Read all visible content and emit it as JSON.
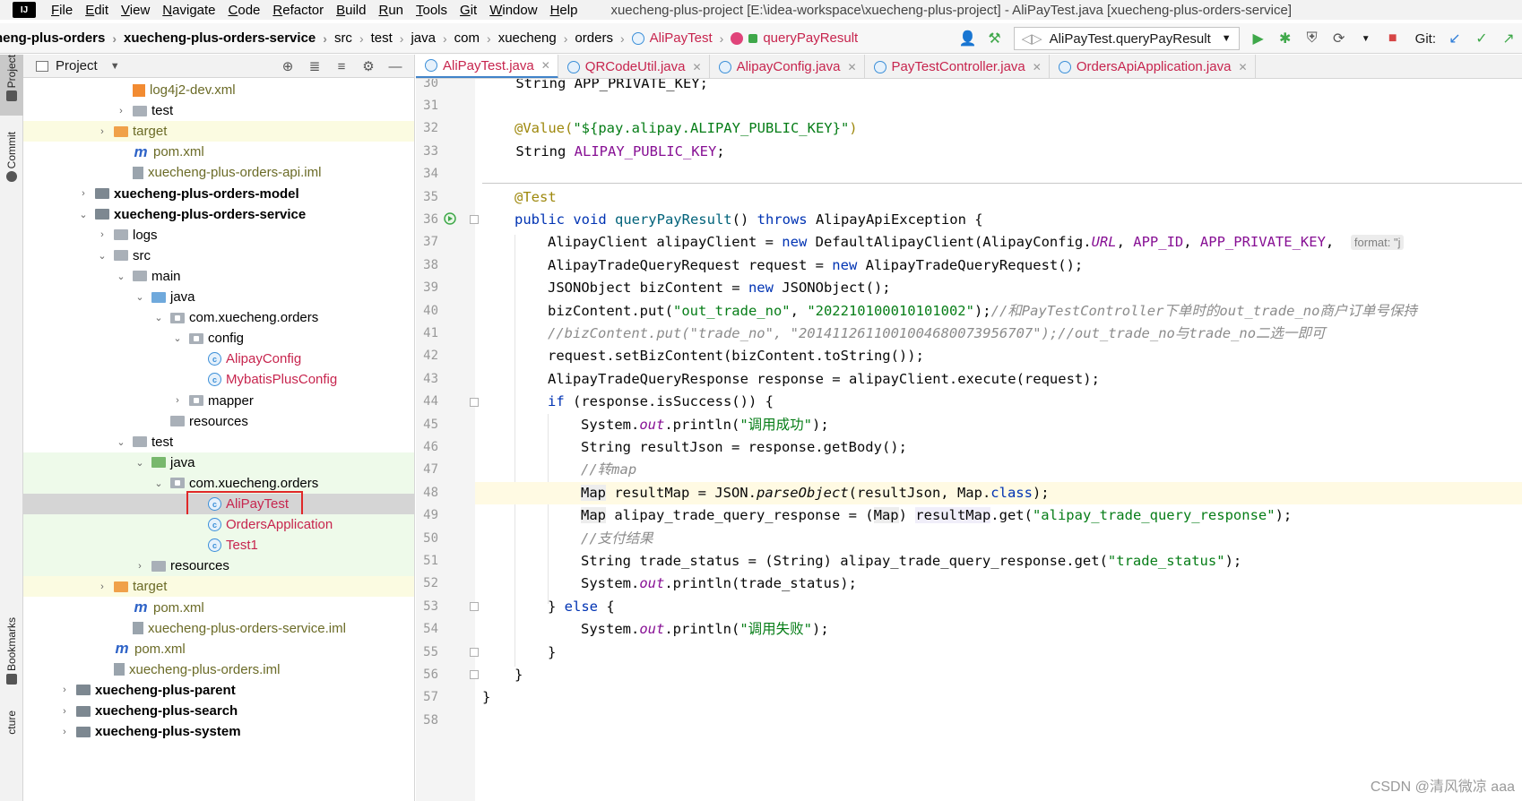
{
  "menubar": {
    "logo": "IJ",
    "items": [
      "File",
      "Edit",
      "View",
      "Navigate",
      "Code",
      "Refactor",
      "Build",
      "Run",
      "Tools",
      "Git",
      "Window",
      "Help"
    ],
    "title": "xuecheng-plus-project [E:\\idea-workspace\\xuecheng-plus-project] - AliPayTest.java [xuecheng-plus-orders-service]"
  },
  "navbar": {
    "crumbs": [
      "heng-plus-orders",
      "xuecheng-plus-orders-service",
      "src",
      "test",
      "java",
      "com",
      "xuecheng",
      "orders",
      "AliPayTest",
      "queryPayResult"
    ],
    "run_config": "AliPayTest.queryPayResult",
    "git_label": "Git:"
  },
  "left_strip": {
    "project": "Project",
    "commit": "Commit",
    "bookmarks": "Bookmarks",
    "structure": "cture"
  },
  "project_panel": {
    "title": "Project",
    "tree": [
      {
        "label": "log4j2-dev.xml",
        "depth": 4,
        "icon": "xml",
        "style": "olive",
        "arrow": ""
      },
      {
        "label": "test",
        "depth": 4,
        "icon": "folder",
        "style": "",
        "arrow": "›"
      },
      {
        "label": "target",
        "depth": 3,
        "icon": "folder-orange",
        "style": "olive",
        "arrow": "›",
        "bg": "yellow"
      },
      {
        "label": "pom.xml",
        "depth": 4,
        "icon": "maven",
        "style": "olive",
        "arrow": ""
      },
      {
        "label": "xuecheng-plus-orders-api.iml",
        "depth": 4,
        "icon": "iml",
        "style": "olive",
        "arrow": ""
      },
      {
        "label": "xuecheng-plus-orders-model",
        "depth": 2,
        "icon": "module",
        "style": "bold",
        "arrow": "›"
      },
      {
        "label": "xuecheng-plus-orders-service",
        "depth": 2,
        "icon": "module",
        "style": "bold",
        "arrow": "⌄"
      },
      {
        "label": "logs",
        "depth": 3,
        "icon": "folder",
        "style": "",
        "arrow": "›"
      },
      {
        "label": "src",
        "depth": 3,
        "icon": "folder",
        "style": "",
        "arrow": "⌄"
      },
      {
        "label": "main",
        "depth": 4,
        "icon": "folder",
        "style": "",
        "arrow": "⌄"
      },
      {
        "label": "java",
        "depth": 5,
        "icon": "folder-blue",
        "style": "",
        "arrow": "⌄"
      },
      {
        "label": "com.xuecheng.orders",
        "depth": 6,
        "icon": "package",
        "style": "",
        "arrow": "⌄"
      },
      {
        "label": "config",
        "depth": 7,
        "icon": "package",
        "style": "",
        "arrow": "⌄"
      },
      {
        "label": "AlipayConfig",
        "depth": 8,
        "icon": "class",
        "style": "red",
        "arrow": ""
      },
      {
        "label": "MybatisPlusConfig",
        "depth": 8,
        "icon": "class",
        "style": "red",
        "arrow": ""
      },
      {
        "label": "mapper",
        "depth": 7,
        "icon": "package",
        "style": "",
        "arrow": "›"
      },
      {
        "label": "resources",
        "depth": 6,
        "icon": "folder",
        "style": "",
        "arrow": ""
      },
      {
        "label": "test",
        "depth": 4,
        "icon": "folder",
        "style": "",
        "arrow": "⌄"
      },
      {
        "label": "java",
        "depth": 5,
        "icon": "folder-green",
        "style": "",
        "arrow": "⌄",
        "bg": "green"
      },
      {
        "label": "com.xuecheng.orders",
        "depth": 6,
        "icon": "package",
        "style": "",
        "arrow": "⌄",
        "bg": "green"
      },
      {
        "label": "AliPayTest",
        "depth": 8,
        "icon": "class",
        "style": "red",
        "arrow": "",
        "bg": "selected"
      },
      {
        "label": "OrdersApplication",
        "depth": 8,
        "icon": "class",
        "style": "red",
        "arrow": "",
        "bg": "green"
      },
      {
        "label": "Test1",
        "depth": 8,
        "icon": "class",
        "style": "red",
        "arrow": "",
        "bg": "green"
      },
      {
        "label": "resources",
        "depth": 5,
        "icon": "folder",
        "style": "",
        "arrow": "›",
        "bg": "green"
      },
      {
        "label": "target",
        "depth": 3,
        "icon": "folder-orange",
        "style": "olive",
        "arrow": "›",
        "bg": "yellow"
      },
      {
        "label": "pom.xml",
        "depth": 4,
        "icon": "maven",
        "style": "olive",
        "arrow": ""
      },
      {
        "label": "xuecheng-plus-orders-service.iml",
        "depth": 4,
        "icon": "iml",
        "style": "olive",
        "arrow": ""
      },
      {
        "label": "pom.xml",
        "depth": 3,
        "icon": "maven",
        "style": "olive",
        "arrow": ""
      },
      {
        "label": "xuecheng-plus-orders.iml",
        "depth": 3,
        "icon": "iml",
        "style": "olive",
        "arrow": ""
      },
      {
        "label": "xuecheng-plus-parent",
        "depth": 1,
        "icon": "module",
        "style": "bold",
        "arrow": "›"
      },
      {
        "label": "xuecheng-plus-search",
        "depth": 1,
        "icon": "module",
        "style": "bold",
        "arrow": "›"
      },
      {
        "label": "xuecheng-plus-system",
        "depth": 1,
        "icon": "module",
        "style": "bold",
        "arrow": "›"
      }
    ]
  },
  "editor": {
    "tabs": [
      {
        "label": "AliPayTest.java",
        "active": true
      },
      {
        "label": "QRCodeUtil.java",
        "active": false
      },
      {
        "label": "AlipayConfig.java",
        "active": false
      },
      {
        "label": "PayTestController.java",
        "active": false
      },
      {
        "label": "OrdersApiApplication.java",
        "active": false
      }
    ],
    "line_numbers": [
      "30",
      "31",
      "32",
      "33",
      "34",
      "35",
      "36",
      "37",
      "38",
      "39",
      "40",
      "41",
      "42",
      "43",
      "44",
      "45",
      "46",
      "47",
      "48",
      "49",
      "50",
      "51",
      "52",
      "53",
      "54",
      "55",
      "56",
      "57",
      "58"
    ],
    "code": {
      "l30": "    String APP_PRIVATE_KEY;",
      "l32_ann": "@Value(",
      "l32_str": "\"${pay.alipay.ALIPAY_PUBLIC_KEY}\"",
      "l32_end": ")",
      "l33": "    String ",
      "l33_fld": "ALIPAY_PUBLIC_KEY",
      "l35": "@Test",
      "l36_kw1": "public void ",
      "l36_name": "queryPayResult",
      "l36_mid": "() ",
      "l36_kw2": "throws",
      "l36_rest": " AlipayApiException {",
      "l37_a": "AlipayClient alipayClient = ",
      "l37_new": "new",
      "l37_b": " DefaultAlipayClient(AlipayConfig.",
      "l37_url": "URL",
      "l37_c": ", ",
      "l37_appid": "APP_ID",
      "l37_d": ", ",
      "l37_pk": "APP_PRIVATE_KEY",
      "l37_e": ",  ",
      "l37_hint": "format: \"j",
      "l38_a": "AlipayTradeQueryRequest request = ",
      "l38_new": "new",
      "l38_b": " AlipayTradeQueryRequest();",
      "l39_a": "JSONObject bizContent = ",
      "l39_new": "new",
      "l39_b": " JSONObject();",
      "l40_a": "bizContent.put(",
      "l40_s1": "\"out_trade_no\"",
      "l40_b": ", ",
      "l40_s2": "\"202210100010101002\"",
      "l40_c": ");",
      "l40_cm": "//和PayTestController下单时的out_trade_no商户订单号保持",
      "l41_cm": "//bizContent.put(\"trade_no\", \"2014112611001004680073956707\");//out_trade_no与trade_no二选一即可",
      "l42": "request.setBizContent(bizContent.toString());",
      "l43": "AlipayTradeQueryResponse response = alipayClient.execute(request);",
      "l44_kw": "if",
      "l44_rest": " (response.isSuccess()) {",
      "l45_a": "System.",
      "l45_out": "out",
      "l45_b": ".println(",
      "l45_s": "\"调用成功\"",
      "l45_c": ");",
      "l46": "String resultJson = response.getBody();",
      "l47_cm": "//转map",
      "l48_a": "Map",
      "l48_b": " resultMap = JSON.",
      "l48_m": "parseObject",
      "l48_c": "(resultJson, Map.",
      "l48_kw": "class",
      "l48_d": ");",
      "l49_a": "Map",
      "l49_b": " alipay_trade_query_response = (",
      "l49_map": "Map",
      "l49_c": ") ",
      "l49_rm": "resultMap",
      "l49_d": ".get(",
      "l49_s": "\"alipay_trade_query_response\"",
      "l49_e": ");",
      "l50_cm": "//支付结果",
      "l51_a": "String trade_status = (String) alipay_trade_query_response.get(",
      "l51_s": "\"trade_status\"",
      "l51_b": ");",
      "l52_a": "System.",
      "l52_out": "out",
      "l52_b": ".println(trade_status);",
      "l53_a": "} ",
      "l53_kw": "else",
      "l53_b": " {",
      "l54_a": "System.",
      "l54_out": "out",
      "l54_b": ".println(",
      "l54_s": "\"调用失败\"",
      "l54_c": ");",
      "l55": "}",
      "l56": "}",
      "l57": "}"
    }
  },
  "watermark": "CSDN @清风微凉 aaa",
  "colors": {
    "keyword": "#0033b3",
    "string": "#067d17",
    "annotation": "#9e880d",
    "comment": "#8c8c8c",
    "field": "#871094",
    "highlight_box": "#e02828"
  }
}
